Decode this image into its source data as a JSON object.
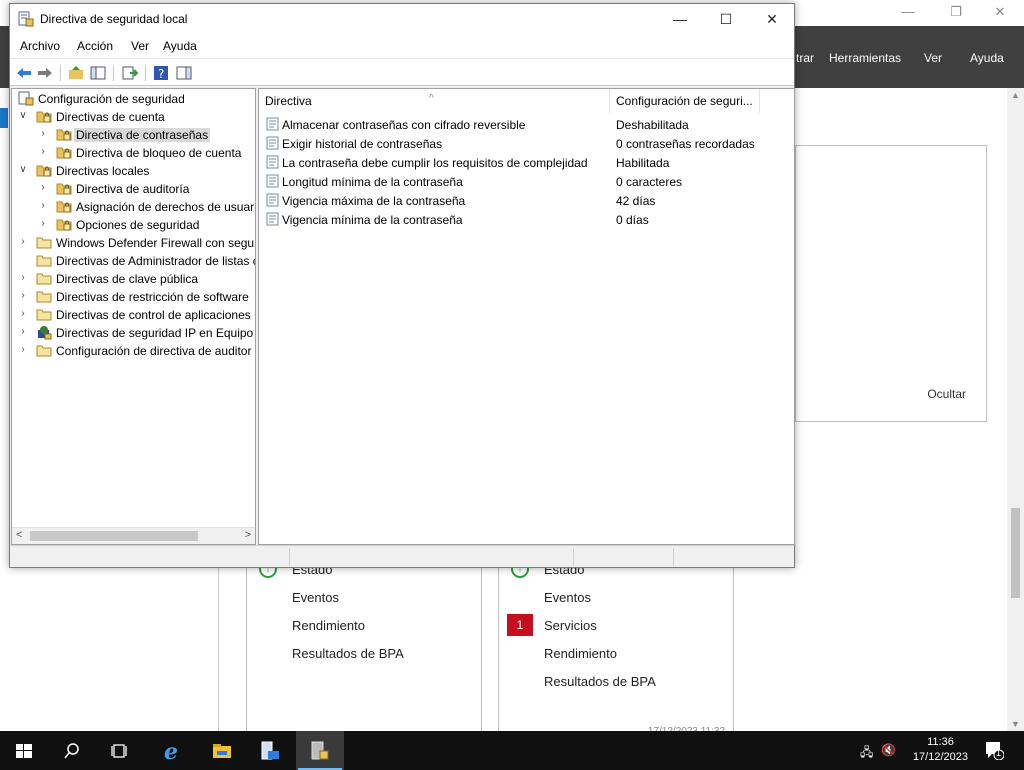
{
  "background": {
    "menus": [
      "trar",
      "Herramientas",
      "Ver",
      "Ayuda"
    ],
    "hide_label": "Ocultar",
    "tile_left": {
      "items": [
        "Estado",
        "Eventos",
        "Rendimiento",
        "Resultados de BPA"
      ]
    },
    "tile_right": {
      "badge": "1",
      "items": [
        "Estado",
        "Eventos",
        "Servicios",
        "Rendimiento",
        "Resultados de BPA"
      ],
      "timestamp": "17/12/2023 11:32"
    }
  },
  "window": {
    "title": "Directiva de seguridad local",
    "menu": [
      "Archivo",
      "Acción",
      "Ver",
      "Ayuda"
    ],
    "controls": {
      "minimize": "—",
      "maximize": "☐",
      "close": "✕"
    }
  },
  "tree": {
    "root": "Configuración de seguridad",
    "items": [
      {
        "label": "Directivas de cuenta",
        "expander": "expanded",
        "level": 1
      },
      {
        "label": "Directiva de contraseñas",
        "expander": "collapsed",
        "level": 2,
        "selected": true
      },
      {
        "label": "Directiva de bloqueo de cuenta",
        "expander": "collapsed",
        "level": 2
      },
      {
        "label": "Directivas locales",
        "expander": "expanded",
        "level": 1
      },
      {
        "label": "Directiva de auditoría",
        "expander": "collapsed",
        "level": 2
      },
      {
        "label": "Asignación de derechos de usuari",
        "expander": "collapsed",
        "level": 2
      },
      {
        "label": "Opciones de seguridad",
        "expander": "collapsed",
        "level": 2
      },
      {
        "label": "Windows Defender Firewall con segur",
        "expander": "collapsed",
        "level": 1
      },
      {
        "label": "Directivas de Administrador de listas c",
        "expander": "none",
        "level": 1
      },
      {
        "label": "Directivas de clave pública",
        "expander": "collapsed",
        "level": 1
      },
      {
        "label": "Directivas de restricción de software",
        "expander": "collapsed",
        "level": 1
      },
      {
        "label": "Directivas de control de aplicaciones",
        "expander": "collapsed",
        "level": 1
      },
      {
        "label": "Directivas de seguridad IP en Equipo l",
        "expander": "collapsed",
        "level": 1
      },
      {
        "label": "Configuración de directiva de auditor",
        "expander": "collapsed",
        "level": 1
      }
    ]
  },
  "list": {
    "columns": [
      "Directiva",
      "Configuración de seguri..."
    ],
    "rows": [
      {
        "policy": "Almacenar contraseñas con cifrado reversible",
        "setting": "Deshabilitada"
      },
      {
        "policy": "Exigir historial de contraseñas",
        "setting": "0 contraseñas recordadas"
      },
      {
        "policy": "La contraseña debe cumplir los requisitos de complejidad",
        "setting": "Habilitada"
      },
      {
        "policy": "Longitud mínima de la contraseña",
        "setting": "0 caracteres"
      },
      {
        "policy": "Vigencia máxima de la contraseña",
        "setting": "42 días"
      },
      {
        "policy": "Vigencia mínima de la contraseña",
        "setting": "0 días"
      }
    ]
  },
  "taskbar": {
    "time": "11:36",
    "date": "17/12/2023",
    "notification_count": "1"
  },
  "colors": {
    "accent": "#1979ca",
    "folder": "#e8c25a",
    "taskbar": "#101010",
    "badge": "#c50f1f"
  }
}
